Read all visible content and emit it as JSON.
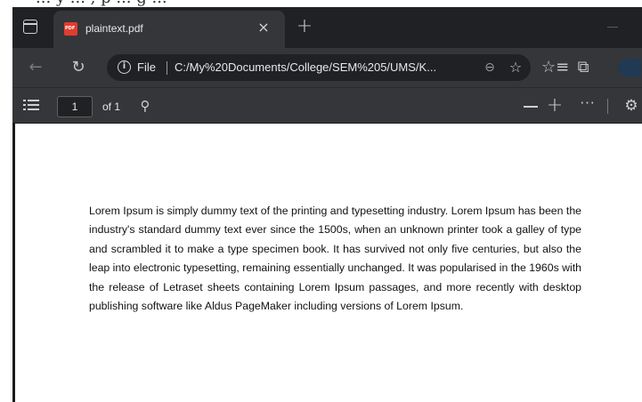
{
  "top_strip": {
    "text": "... y ... , p ... g ..."
  },
  "window": {
    "tab": {
      "title": "plaintext.pdf",
      "close_glyph": "×",
      "icon": "pdf-file-icon"
    },
    "new_tab_glyph": "+",
    "address_bar": {
      "back_glyph": "←",
      "refresh_glyph": "↻",
      "security_glyph": "i",
      "scheme_label": "File",
      "url": "C:/My%20Documents/College/SEM%205/UMS/K...",
      "zoom_glyph": "⊖",
      "favorite_glyph": "☆",
      "favorites_glyph": "☆≡",
      "collections_glyph": "⧉"
    },
    "pdf_toolbar": {
      "page_number": "1",
      "page_count_label": "of 1",
      "search_glyph": "⚲",
      "zoom_in_glyph": "+",
      "more_glyph": "···",
      "settings_glyph": "⚙"
    },
    "document": {
      "paragraph": "Lorem Ipsum is simply dummy text of the printing and typesetting industry. Lorem Ipsum has been the industry's standard dummy text ever since the 1500s, when an unknown printer took a galley of type and scrambled it to make a type specimen book. It has survived not only five centuries, but also the leap into electronic typesetting, remaining essentially unchanged. It was popularised in the 1960s with the release of Letraset sheets containing Lorem Ipsum passages, and more recently with desktop publishing software like Aldus PageMaker including versions of Lorem Ipsum."
    }
  },
  "colors": {
    "tab_strip": "#202124",
    "toolbar": "#35363a",
    "page": "#ffffff",
    "pdf_icon": "#e03d2f"
  }
}
